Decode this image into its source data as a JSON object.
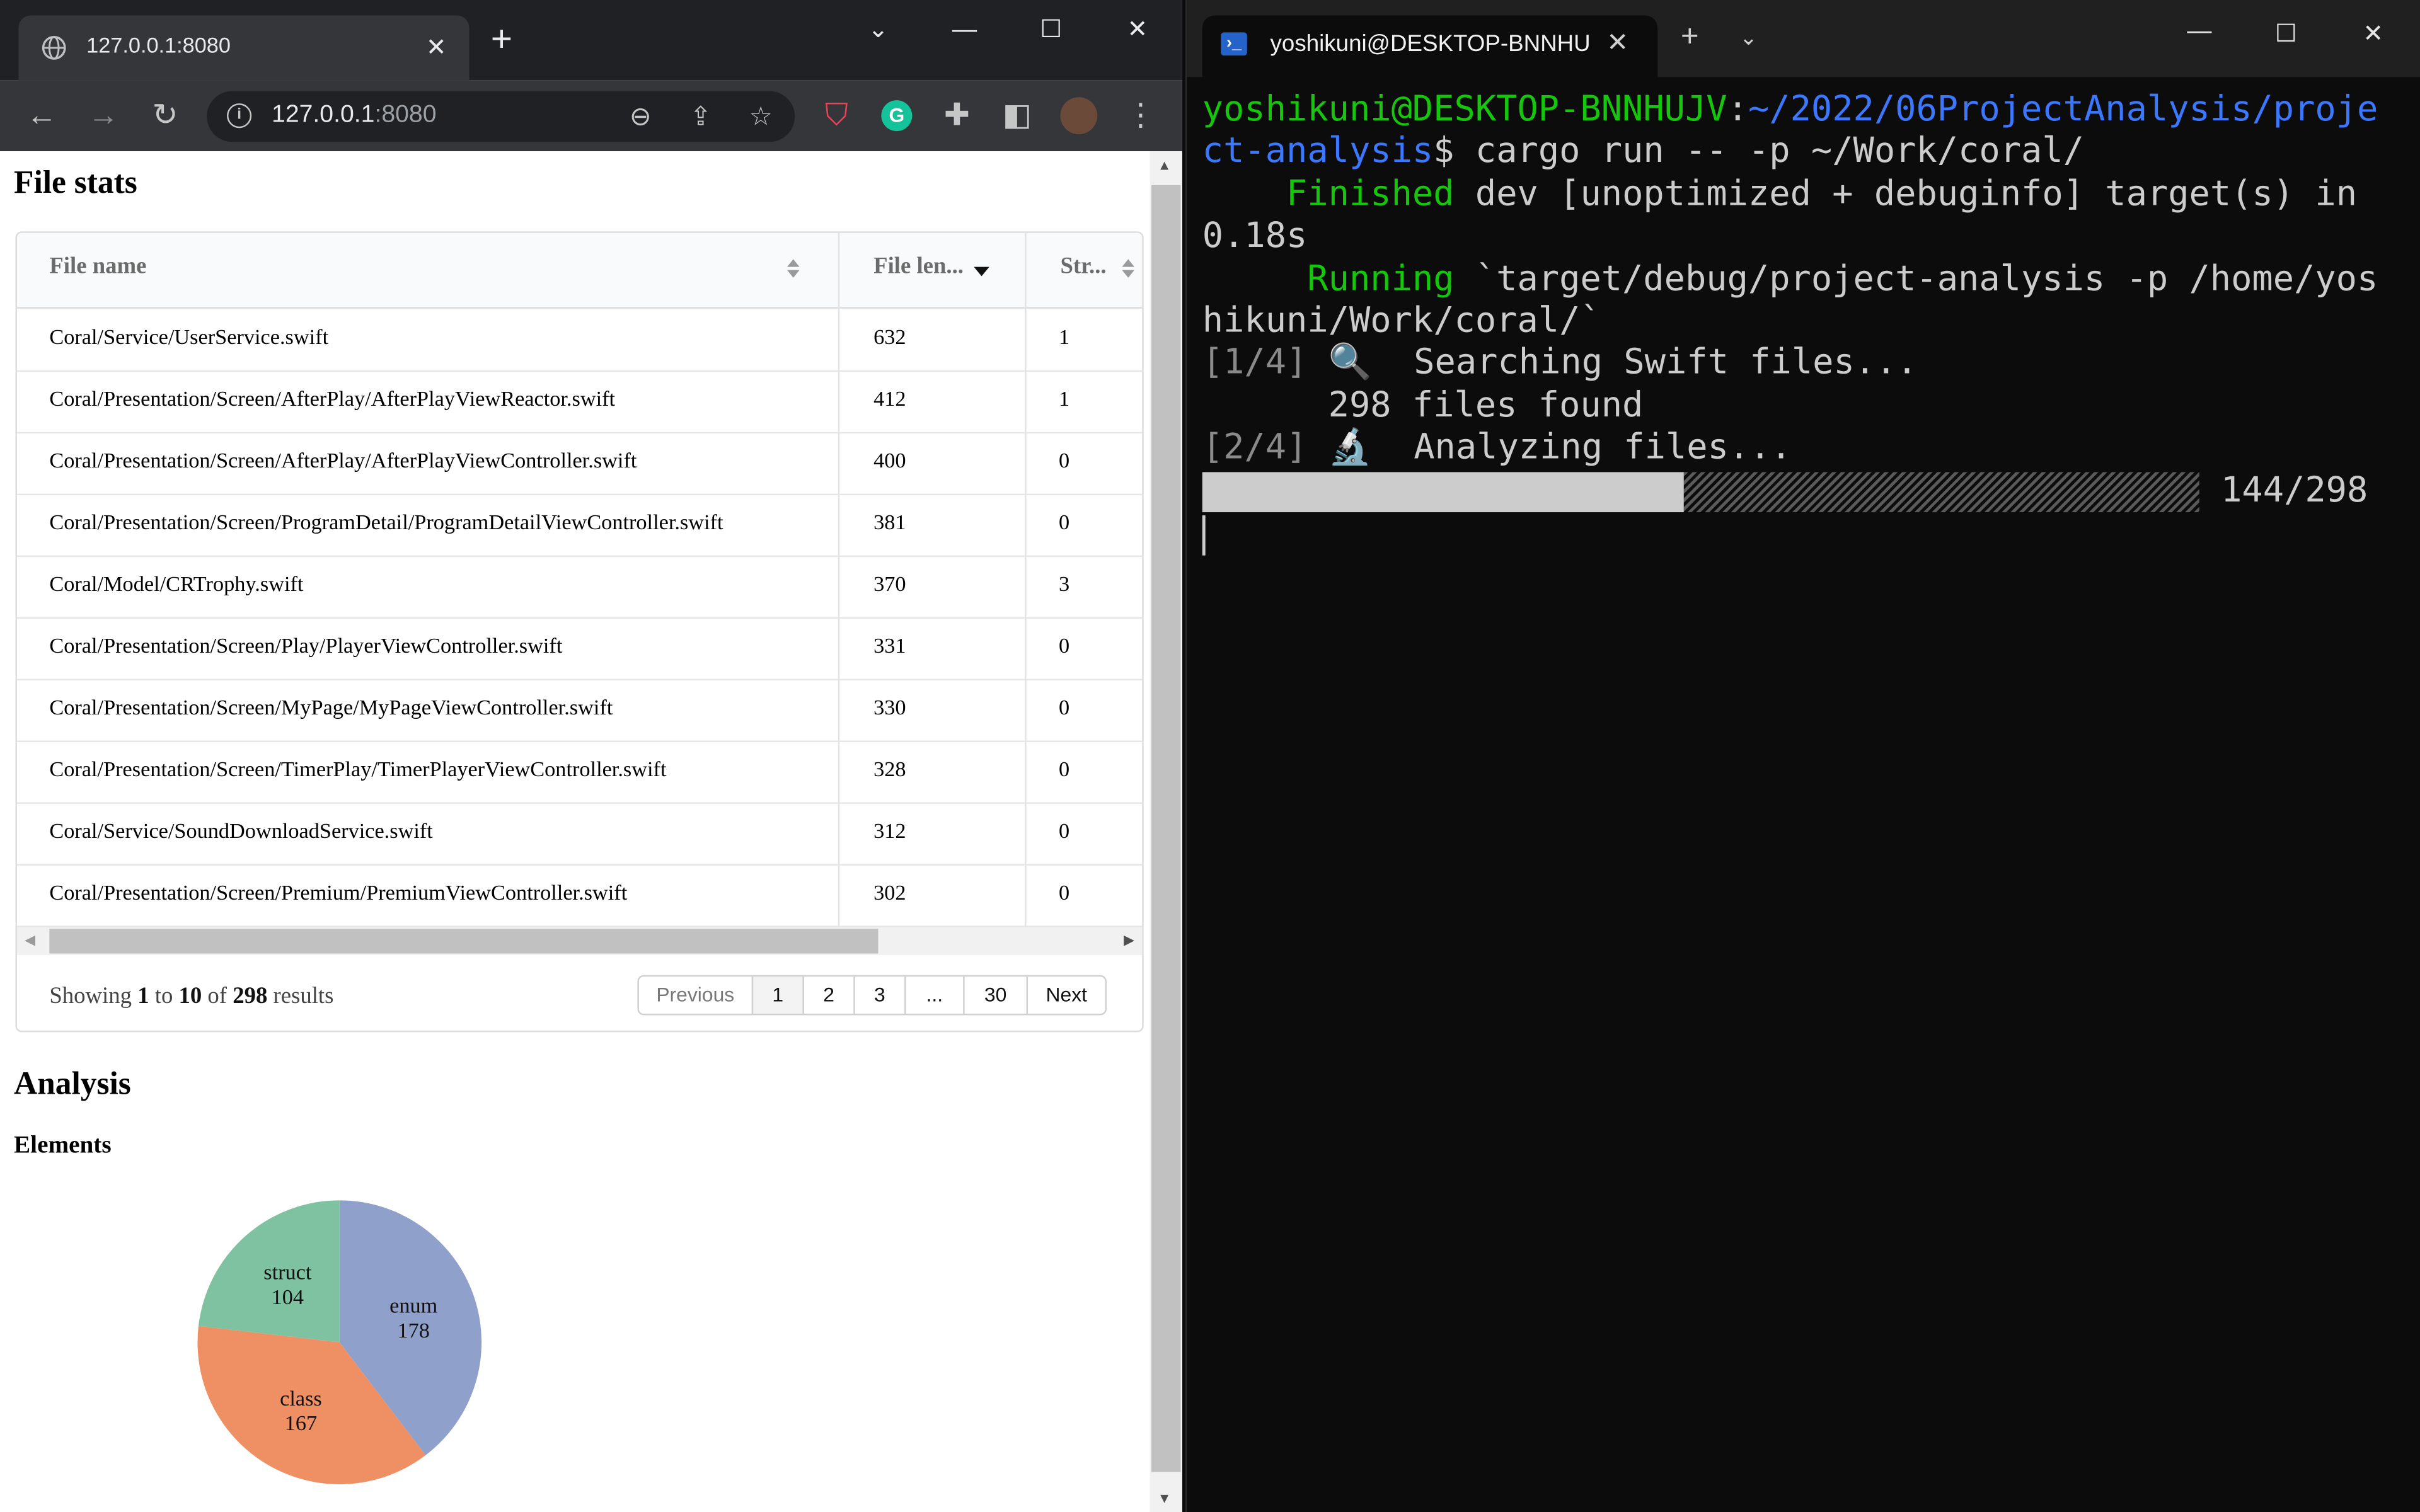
{
  "browser": {
    "tab_title": "127.0.0.1:8080",
    "new_tab_symbol": "+",
    "url_host": "127.0.0.1",
    "url_port": ":8080",
    "page": {
      "file_stats_heading": "File stats",
      "columns": [
        "File name",
        "File len...",
        "Str..."
      ],
      "rows": [
        {
          "name": "Coral/Service/UserService.swift",
          "len": "632",
          "str": "1"
        },
        {
          "name": "Coral/Presentation/Screen/AfterPlay/AfterPlayViewReactor.swift",
          "len": "412",
          "str": "1"
        },
        {
          "name": "Coral/Presentation/Screen/AfterPlay/AfterPlayViewController.swift",
          "len": "400",
          "str": "0"
        },
        {
          "name": "Coral/Presentation/Screen/ProgramDetail/ProgramDetailViewController.swift",
          "len": "381",
          "str": "0"
        },
        {
          "name": "Coral/Model/CRTrophy.swift",
          "len": "370",
          "str": "3"
        },
        {
          "name": "Coral/Presentation/Screen/Play/PlayerViewController.swift",
          "len": "331",
          "str": "0"
        },
        {
          "name": "Coral/Presentation/Screen/MyPage/MyPageViewController.swift",
          "len": "330",
          "str": "0"
        },
        {
          "name": "Coral/Presentation/Screen/TimerPlay/TimerPlayerViewController.swift",
          "len": "328",
          "str": "0"
        },
        {
          "name": "Coral/Service/SoundDownloadService.swift",
          "len": "312",
          "str": "0"
        },
        {
          "name": "Coral/Presentation/Screen/Premium/PremiumViewController.swift",
          "len": "302",
          "str": "0"
        }
      ],
      "pagination": {
        "showing_prefix": "Showing",
        "from": "1",
        "to_word": "to",
        "to": "10",
        "of_word": "of",
        "total": "298",
        "suffix": "results",
        "prev_label": "Previous",
        "pages": [
          "1",
          "2",
          "3",
          "...",
          "30"
        ],
        "current_page": "1",
        "next_label": "Next"
      },
      "analysis_heading": "Analysis",
      "elements_heading": "Elements"
    }
  },
  "chart_data": {
    "type": "pie",
    "title": "",
    "labels": [
      "enum",
      "class",
      "struct"
    ],
    "values": [
      178,
      167,
      104
    ],
    "colors": [
      "#8fa0cb",
      "#ef8f64",
      "#7fc2a2"
    ]
  },
  "terminal": {
    "tab_title": "yoshikuni@DESKTOP-BNNHU",
    "prompt_user": "yoshikuni@DESKTOP-BNNHUJV",
    "prompt_colon": ":",
    "prompt_path_1": "~/2022/06ProjectAnalysis/proje",
    "prompt_path_2": "ct-analysis",
    "prompt_dollar": "$",
    "command": " cargo run -- -p ~/Work/coral/",
    "finished_indent": "    ",
    "finished_word": "Finished",
    "finished_rest": " dev [unoptimized + debuginfo] target(s) in",
    "finished_time": "0.18s",
    "running_indent": "     ",
    "running_word": "Running",
    "running_rest_1": " `target/debug/project-analysis -p /home/yos",
    "running_rest_2": "hikuni/Work/coral/`",
    "step1_tag": "[1/4]",
    "step1_icon": " 🔍 ",
    "step1_text": " Searching Swift files...",
    "files_found": "      298 files found",
    "step2_tag": "[2/4]",
    "step2_icon": " 🔬 ",
    "step2_text": " Analyzing files...",
    "progress_done": 144,
    "progress_total": 298,
    "progress_text": "144/298"
  }
}
